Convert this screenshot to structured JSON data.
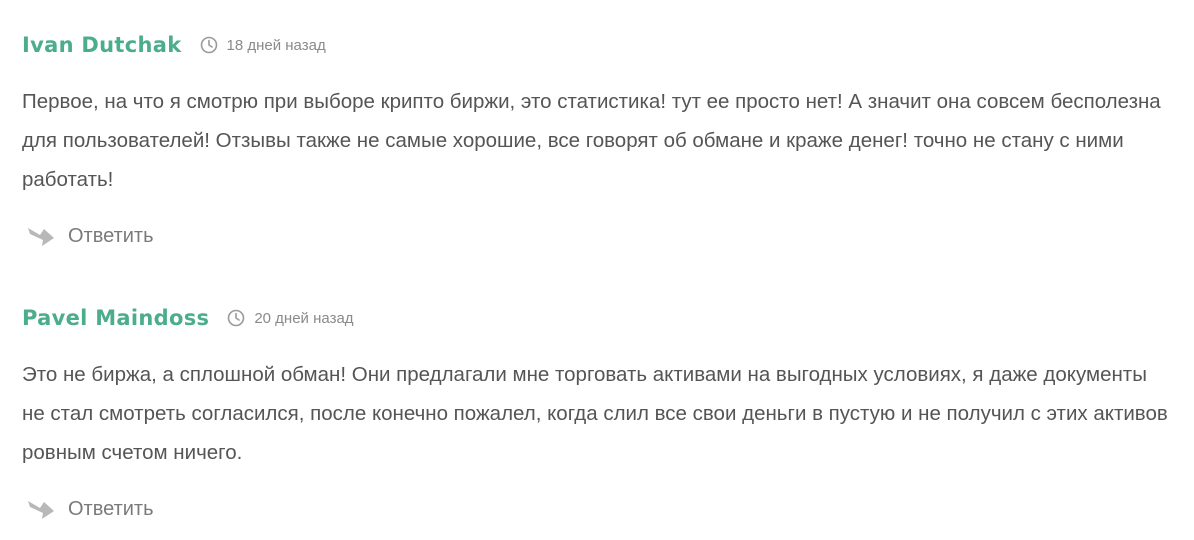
{
  "comments": [
    {
      "author": "Ivan Dutchak",
      "time_icon": "clock-icon",
      "time": "18 дней назад",
      "text": "Первое, на что я смотрю при выборе крипто биржи, это статистика! тут ее просто нет! А значит она совсем бесполезна для пользователей! Отзывы также не самые хорошие, все говорят об обмане и краже денег! точно не стану с ними работать!",
      "reply_icon": "reply-arrow-icon",
      "reply_label": "Ответить"
    },
    {
      "author": "Pavel Maindoss",
      "time_icon": "clock-icon",
      "time": "20 дней назад",
      "text": "Это не биржа, а сплошной обман! Они предлагали мне торговать активами на выгодных условиях, я даже документы не стал смотреть согласился, после конечно пожалел, когда слил все свои деньги в пустую и не получил с этих активов ровным счетом ничего.",
      "reply_icon": "reply-arrow-icon",
      "reply_label": "Ответить"
    }
  ],
  "colors": {
    "author": "#4cad8c",
    "body_text": "#555555",
    "meta_text": "#8a8a8a",
    "reply_icon": "#b8b8b8"
  }
}
